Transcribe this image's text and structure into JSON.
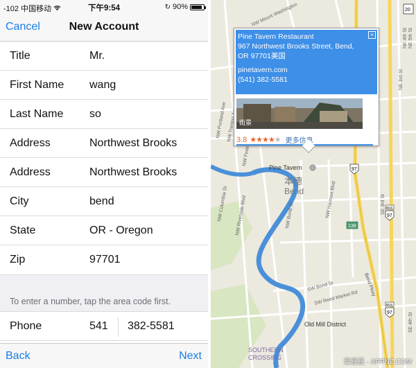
{
  "status_bar": {
    "signal": "-102",
    "carrier": "中国移动",
    "time": "下午9:54",
    "battery": "90%",
    "battery_level": 0.9
  },
  "nav": {
    "cancel": "Cancel",
    "title": "New Account"
  },
  "form": {
    "rows": [
      {
        "label": "Title",
        "value": "Mr."
      },
      {
        "label": "First Name",
        "value": "wang"
      },
      {
        "label": "Last Name",
        "value": "so"
      },
      {
        "label": "Address",
        "value": "Northwest Brooks"
      },
      {
        "label": "Address",
        "value": "Northwest Brooks"
      },
      {
        "label": "City",
        "value": "bend"
      },
      {
        "label": "State",
        "value": "OR - Oregon"
      },
      {
        "label": "Zip",
        "value": "97701"
      }
    ],
    "hint": "To enter a number, tap the area code first.",
    "phone": {
      "label": "Phone",
      "area": "541",
      "number": "382-5581"
    }
  },
  "toolbar": {
    "back": "Back",
    "next": "Next"
  },
  "map": {
    "popup": {
      "name": "Pine Tavern Restaurant",
      "address_line1": "967 Northwest Brooks Street, Bend,",
      "address_line2": "OR 97701美国",
      "website": "pinetavern.com",
      "phone": "(541) 382-5581",
      "photo_label": "街景",
      "rating": "3.8",
      "rating_stars": 4,
      "more": "更多信息",
      "close": "×"
    },
    "labels": {
      "pine_tavern": "Pine Tavern",
      "bend_cn": "本德",
      "bend": "Bend",
      "old_mill": "Old Mill District",
      "southern_crossing_1": "SOUTHERN",
      "southern_crossing_2": "CROSSING",
      "hwy_97": "97",
      "hwy_20": "20",
      "hwy_138": "138",
      "bus": "BUS",
      "nw_mount_washington": "NW Mount Washington",
      "ne_3rd": "NE 3rd St",
      "ne_4th": "NE 4th St",
      "ne_5th": "NE 5th St",
      "bend_pkwy": "Bend Pkwy",
      "nw_columbia": "NW Columbia St",
      "nw_riverside": "NW Riverside Blvd",
      "sw_bond": "SW Bond St",
      "nw_harmon": "NW Harmon Blvd",
      "nw_trenton": "NW Trenton Ave",
      "nw_portland": "NW Portland Ave",
      "nw_bond": "NW Bond St",
      "nw_federal": "NW Federal St",
      "sw_reed_mkt": "SW Reed Market Rd",
      "se_3rd": "SE 3rd St",
      "se_4th": "SE 4th St"
    },
    "colors": {
      "water": "#4a90d9",
      "road_major": "#f6d55a",
      "road_minor": "#ffffff",
      "land": "#ece9df",
      "park": "#c9dfae"
    }
  },
  "watermark": "爱屁屁 · APPNZ.COM"
}
